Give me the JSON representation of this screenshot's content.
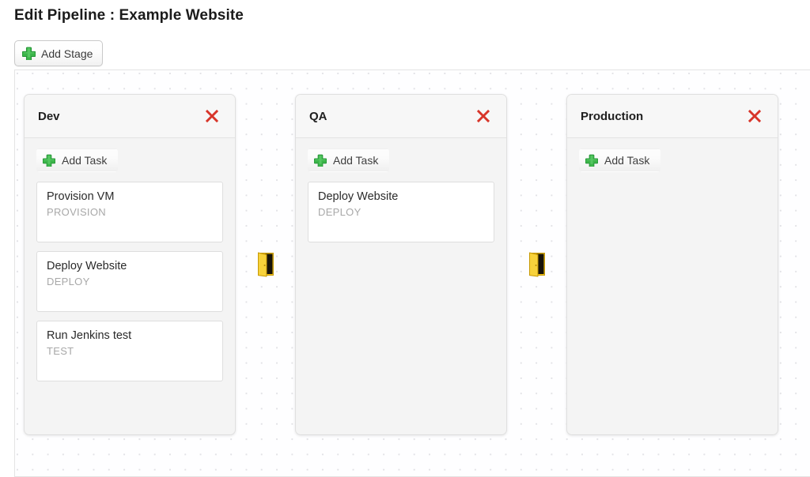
{
  "page": {
    "title": "Edit Pipeline : Example Website"
  },
  "toolbar": {
    "add_stage_label": "Add Stage",
    "add_stage_icon": "plus-icon"
  },
  "colors": {
    "accent_green": "#3cb54a",
    "delete_red": "#d8352a",
    "door_yellow": "#f2c314",
    "canvas_bg": "#fefeff",
    "stage_bg": "#f4f4f4",
    "task_bg": "#ffffff",
    "title_text": "#1b1b1b",
    "task_type_text": "#a8a8a8"
  },
  "canvas": {
    "grid": "dotted",
    "add_task_label": "Add Task",
    "add_task_icon": "plus-icon",
    "delete_icon": "close-x-icon",
    "gate_icon": "door-icon",
    "stages": [
      {
        "name": "Dev",
        "tasks": [
          {
            "name": "Provision VM",
            "type": "PROVISION"
          },
          {
            "name": "Deploy Website",
            "type": "DEPLOY"
          },
          {
            "name": "Run Jenkins test",
            "type": "TEST"
          }
        ]
      },
      {
        "name": "QA",
        "tasks": [
          {
            "name": "Deploy Website",
            "type": "DEPLOY"
          }
        ]
      },
      {
        "name": "Production",
        "tasks": []
      }
    ]
  }
}
